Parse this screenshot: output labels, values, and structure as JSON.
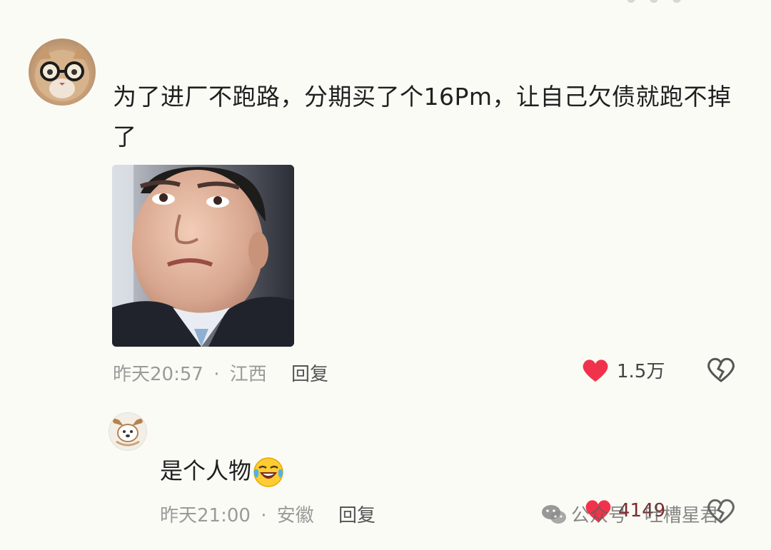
{
  "comment_main": {
    "text": "为了进厂不跑路，分期买了个16Pm，让自己欠债就跑不掉了",
    "time": "昨天20:57",
    "location": "江西",
    "separator": "·",
    "reply_label": "回复",
    "like_count": "1.5万"
  },
  "comment_reply": {
    "text": "是个人物",
    "emoji": "laughing-crying-emoji",
    "time": "昨天21:00",
    "location": "安徽",
    "separator": "·",
    "reply_label": "回复",
    "like_count": "4149"
  },
  "watermark": {
    "text": "公众号 · 吐槽星君",
    "icon": "wechat-icon"
  },
  "colors": {
    "background": "#fbfbf6",
    "like_heart": "#f0334b",
    "meta_gray": "#9a9a9a"
  },
  "icons": {
    "like": "heart-filled-icon",
    "dislike": "broken-heart-icon"
  }
}
